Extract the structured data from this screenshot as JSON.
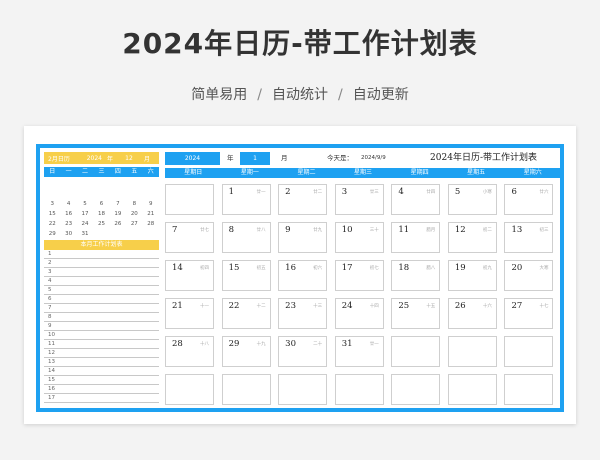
{
  "header": {
    "title": "2024年日历-带工作计划表",
    "features": [
      "简单易用",
      "自动统计",
      "自动更新"
    ],
    "separator": "/"
  },
  "mini_calendar": {
    "month_label": "2月日历",
    "year": "2024",
    "year_unit": "年",
    "month_control": "12",
    "month_unit": "月",
    "weekdays": [
      "日",
      "一",
      "二",
      "三",
      "四",
      "五",
      "六"
    ],
    "rows": [
      [
        "",
        "",
        "",
        "",
        "",
        "",
        ""
      ],
      [
        "",
        "",
        "",
        "",
        "",
        "",
        ""
      ],
      [
        "3",
        "4",
        "5",
        "6",
        "7",
        "8",
        "9"
      ],
      [
        "15",
        "16",
        "17",
        "18",
        "19",
        "20",
        "21"
      ],
      [
        "22",
        "23",
        "24",
        "25",
        "26",
        "27",
        "28"
      ],
      [
        "29",
        "30",
        "31",
        "",
        "",
        "",
        ""
      ]
    ]
  },
  "plan": {
    "title": "本月工作计划表",
    "numbers": [
      "1",
      "2",
      "3",
      "4",
      "5",
      "6",
      "7",
      "8",
      "9",
      "10",
      "11",
      "12",
      "13",
      "14",
      "15",
      "16",
      "17"
    ]
  },
  "calendar": {
    "year": "2024",
    "year_unit": "年",
    "month": "1",
    "month_unit": "月",
    "today_label": "今天是：",
    "today_value": "2024/9/9",
    "title": "2024年日历-带工作计划表",
    "weekdays": [
      "星期日",
      "星期一",
      "星期二",
      "星期三",
      "星期四",
      "星期五",
      "星期六"
    ],
    "weeks": [
      [
        {
          "d": "",
          "l": ""
        },
        {
          "d": "1",
          "l": "廿一"
        },
        {
          "d": "2",
          "l": "廿二"
        },
        {
          "d": "3",
          "l": "廿三"
        },
        {
          "d": "4",
          "l": "廿四"
        },
        {
          "d": "5",
          "l": "小寒"
        },
        {
          "d": "6",
          "l": "廿六"
        }
      ],
      [
        {
          "d": "7",
          "l": "廿七"
        },
        {
          "d": "8",
          "l": "廿八"
        },
        {
          "d": "9",
          "l": "廿九"
        },
        {
          "d": "10",
          "l": "三十"
        },
        {
          "d": "11",
          "l": "腊月"
        },
        {
          "d": "12",
          "l": "初二"
        },
        {
          "d": "13",
          "l": "初三"
        }
      ],
      [
        {
          "d": "14",
          "l": "初四"
        },
        {
          "d": "15",
          "l": "初五"
        },
        {
          "d": "16",
          "l": "初六"
        },
        {
          "d": "17",
          "l": "初七"
        },
        {
          "d": "18",
          "l": "腊八"
        },
        {
          "d": "19",
          "l": "初九"
        },
        {
          "d": "20",
          "l": "大寒"
        }
      ],
      [
        {
          "d": "21",
          "l": "十一"
        },
        {
          "d": "22",
          "l": "十二"
        },
        {
          "d": "23",
          "l": "十三"
        },
        {
          "d": "24",
          "l": "十四"
        },
        {
          "d": "25",
          "l": "十五"
        },
        {
          "d": "26",
          "l": "十六"
        },
        {
          "d": "27",
          "l": "十七"
        }
      ],
      [
        {
          "d": "28",
          "l": "十八"
        },
        {
          "d": "29",
          "l": "十九"
        },
        {
          "d": "30",
          "l": "二十"
        },
        {
          "d": "31",
          "l": "廿一"
        },
        {
          "d": "",
          "l": ""
        },
        {
          "d": "",
          "l": ""
        },
        {
          "d": "",
          "l": ""
        }
      ],
      [
        {
          "d": "",
          "l": ""
        },
        {
          "d": "",
          "l": ""
        },
        {
          "d": "",
          "l": ""
        },
        {
          "d": "",
          "l": ""
        },
        {
          "d": "",
          "l": ""
        },
        {
          "d": "",
          "l": ""
        },
        {
          "d": "",
          "l": ""
        }
      ]
    ]
  },
  "colors": {
    "accent": "#1ea1f1",
    "highlight": "#f7cf4a"
  }
}
